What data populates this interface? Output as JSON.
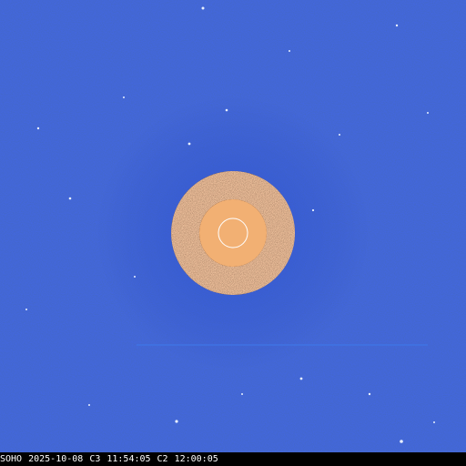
{
  "image": {
    "description_colors": {
      "sky": "#1f3fb8",
      "occulter_ring": "#ffffff",
      "occulter_disk": "#f2b073",
      "sun_outline": "#ffffff"
    }
  },
  "caption": {
    "observatory": "SOHO",
    "date": "2025-10-08",
    "c3_label": "C3",
    "c3_time": "11:54:05",
    "c2_label": "C2",
    "c2_time": "12:00:05"
  }
}
